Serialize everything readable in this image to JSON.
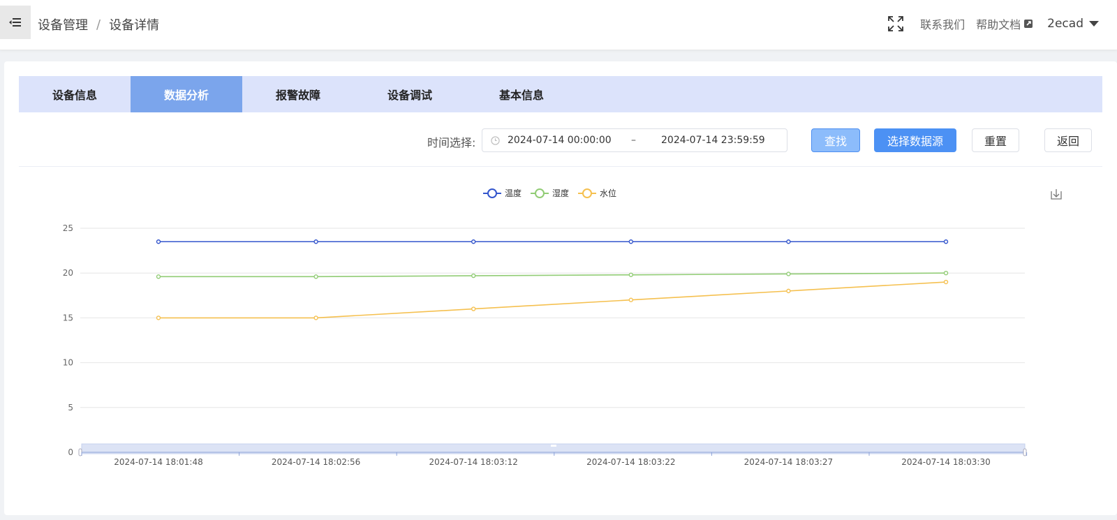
{
  "header": {
    "breadcrumb": [
      "设备管理",
      "设备详情"
    ],
    "breadcrumb_sep": "/",
    "links": {
      "contact": "联系我们",
      "help": "帮助文档"
    },
    "user": "2ecad"
  },
  "tabs": [
    {
      "label": "设备信息",
      "active": false
    },
    {
      "label": "数据分析",
      "active": true
    },
    {
      "label": "报警故障",
      "active": false
    },
    {
      "label": "设备调试",
      "active": false
    },
    {
      "label": "基本信息",
      "active": false
    }
  ],
  "filter": {
    "label": "时间选择:",
    "start": "2024-07-14 00:00:00",
    "sep": "–",
    "end": "2024-07-14 23:59:59",
    "buttons": {
      "search": "查找",
      "source": "选择数据源",
      "reset": "重置",
      "back": "返回"
    }
  },
  "chart_data": {
    "type": "line",
    "x": [
      "2024-07-14 18:01:48",
      "2024-07-14 18:02:56",
      "2024-07-14 18:03:12",
      "2024-07-14 18:03:22",
      "2024-07-14 18:03:27",
      "2024-07-14 18:03:30"
    ],
    "series": [
      {
        "name": "温度",
        "color": "#3355cc",
        "values": [
          23.5,
          23.5,
          23.5,
          23.5,
          23.5,
          23.5
        ]
      },
      {
        "name": "湿度",
        "color": "#91cc75",
        "values": [
          19.6,
          19.6,
          19.7,
          19.8,
          19.9,
          20.0
        ]
      },
      {
        "name": "水位",
        "color": "#f5c04f",
        "values": [
          15,
          15,
          16,
          17,
          18,
          19
        ]
      }
    ],
    "yticks": [
      "0",
      "5",
      "10",
      "15",
      "20",
      "25"
    ],
    "ylim": [
      0,
      25
    ],
    "legend": "top-center",
    "grid": true
  }
}
